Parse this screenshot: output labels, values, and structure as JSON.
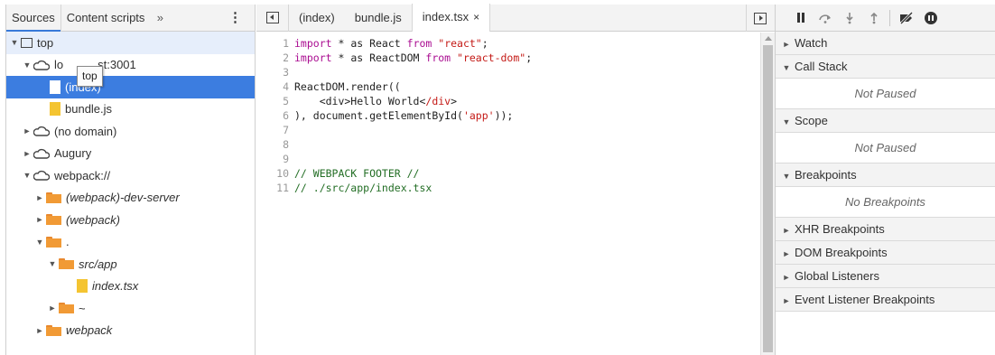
{
  "navigator": {
    "tabs": [
      {
        "label": "Sources"
      },
      {
        "label": "Content scripts"
      }
    ],
    "more_tabs_glyph": "»",
    "menu_glyph": "⋮",
    "tooltip": "top",
    "tree": [
      {
        "label": "top",
        "arrow": "▼"
      },
      {
        "label": "lo",
        "suffix": "st:3001",
        "arrow": "▼"
      },
      {
        "label": "(index)"
      },
      {
        "label": "bundle.js"
      },
      {
        "label": "(no domain)",
        "arrow": "►"
      },
      {
        "label": "Augury",
        "arrow": "►"
      },
      {
        "label": "webpack://",
        "arrow": "▼"
      },
      {
        "label": "(webpack)-dev-server",
        "arrow": "►"
      },
      {
        "label": "(webpack)",
        "arrow": "►"
      },
      {
        "label": ".",
        "arrow": "▼"
      },
      {
        "label": "src/app",
        "arrow": "▼"
      },
      {
        "label": "index.tsx"
      },
      {
        "label": "~",
        "arrow": "►"
      },
      {
        "label": "webpack",
        "arrow": "►"
      }
    ]
  },
  "editor": {
    "tabs": [
      {
        "label": "(index)"
      },
      {
        "label": "bundle.js"
      },
      {
        "label": "index.tsx"
      }
    ],
    "close_glyph": "×",
    "line_numbers": [
      "1",
      "2",
      "3",
      "4",
      "5",
      "6",
      "7",
      "8",
      "9",
      "10",
      "11"
    ],
    "code": {
      "l1_kw1": "import",
      "l1_mid": " * as React ",
      "l1_kw2": "from",
      "l1_str": " \"react\"",
      "l1_end": ";",
      "l2_kw1": "import",
      "l2_mid": " * as ReactDOM ",
      "l2_kw2": "from",
      "l2_str": " \"react-dom\"",
      "l2_end": ";",
      "l4": "ReactDOM.render((",
      "l5_pre": "    <div>Hello World<",
      "l5_tag": "/div",
      "l5_end": ">",
      "l6_pre": "), document.getElementById(",
      "l6_str": "'app'",
      "l6_end": "));",
      "l10": "// WEBPACK FOOTER //",
      "l11": "// ./src/app/index.tsx"
    }
  },
  "debugger": {
    "sections": {
      "watch": "Watch",
      "call_stack": "Call Stack",
      "call_stack_status": "Not Paused",
      "scope": "Scope",
      "scope_status": "Not Paused",
      "breakpoints": "Breakpoints",
      "breakpoints_status": "No Breakpoints",
      "xhr": "XHR Breakpoints",
      "dom": "DOM Breakpoints",
      "global": "Global Listeners",
      "event": "Event Listener Breakpoints"
    },
    "arrows": {
      "collapsed": "►",
      "expanded": "▼"
    }
  },
  "colors": {
    "selection": "#3c7de0",
    "folder": "#f19a35",
    "file": "#f4c431",
    "keyword": "#aa0d91",
    "string": "#c41a16",
    "comment": "#236e25"
  }
}
